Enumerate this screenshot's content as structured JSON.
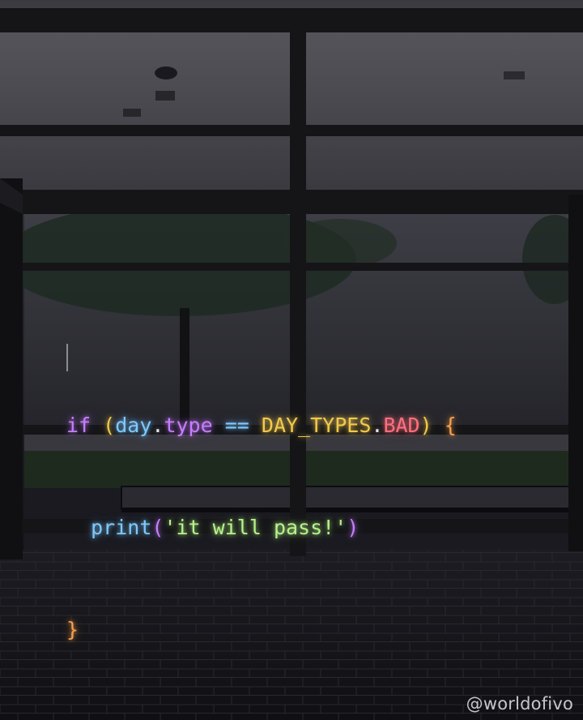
{
  "code": {
    "line1": {
      "kw_if": "if",
      "paren_open": "(",
      "var_day": "day",
      "dot1": ".",
      "prop_type": "type",
      "op_eq": "==",
      "const_day_types": "DAY_TYPES",
      "dot2": ".",
      "const_bad": "BAD",
      "paren_close": ")",
      "brace_open": "{"
    },
    "line2": {
      "fn_print": "print",
      "paren_open": "(",
      "str_quote_open": "'",
      "str_it": "it",
      "str_will": "will",
      "str_pass": "pass!",
      "str_quote_close": "'",
      "paren_close": ")"
    },
    "line3": {
      "brace_close": "}"
    }
  },
  "watermark": "@worldofivo",
  "colors": {
    "keyword": "#c77dff",
    "paren": "#f2c94c",
    "variable": "#7ec8ff",
    "property": "#c77dff",
    "operator": "#7ec8ff",
    "constant": "#f2c94c",
    "constant_bad": "#ff6f7d",
    "brace": "#f6a04d",
    "function": "#7ec8ff",
    "string": "#a7e36a"
  }
}
